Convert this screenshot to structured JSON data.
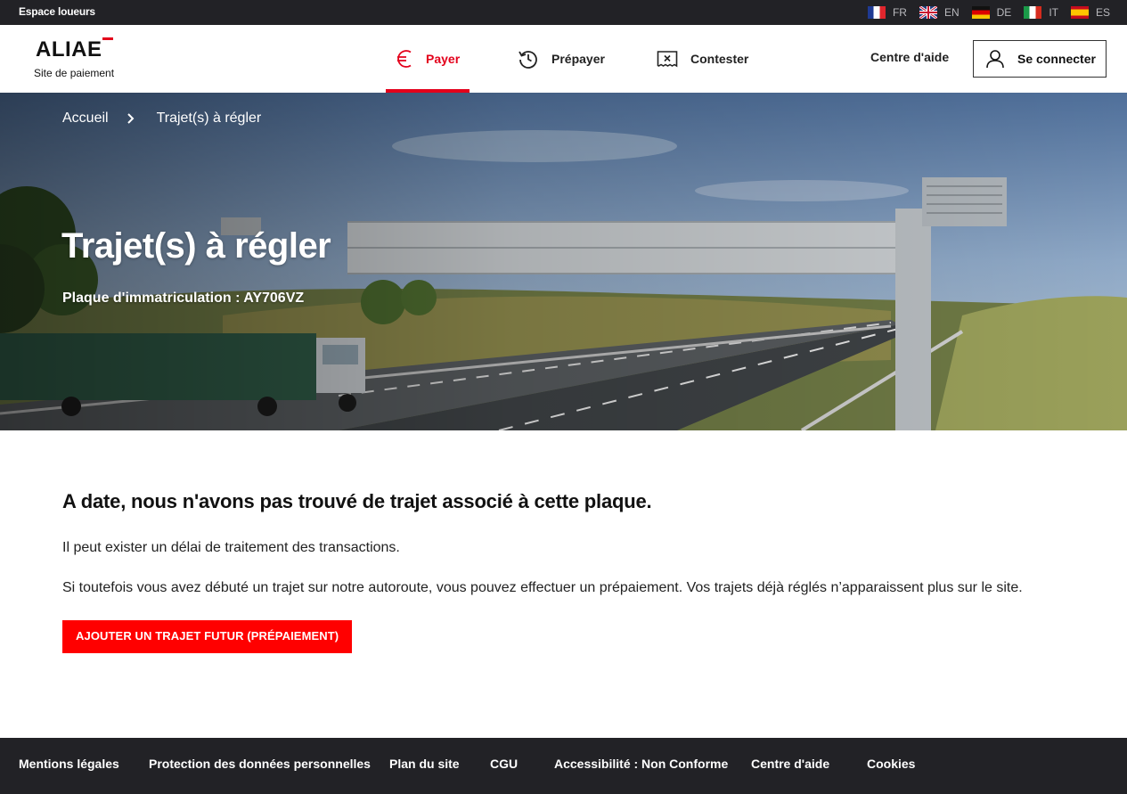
{
  "topbar": {
    "space_label": "Espace loueurs",
    "languages": [
      {
        "code": "FR",
        "flag": "france-flag-icon"
      },
      {
        "code": "EN",
        "flag": "uk-flag-icon"
      },
      {
        "code": "DE",
        "flag": "germany-flag-icon"
      },
      {
        "code": "IT",
        "flag": "italy-flag-icon"
      },
      {
        "code": "ES",
        "flag": "spain-flag-icon"
      }
    ]
  },
  "header": {
    "logo_text": "ALIAE",
    "logo_subtitle": "Site de paiement",
    "nav": [
      {
        "label": "Payer",
        "icon": "euro-icon",
        "active": true
      },
      {
        "label": "Prépayer",
        "icon": "clock-refresh-icon",
        "active": false
      },
      {
        "label": "Contester",
        "icon": "ticket-cancel-icon",
        "active": false
      }
    ],
    "help_label": "Centre d'aide",
    "login_label": "Se connecter",
    "accent_color": "#e3001b"
  },
  "hero": {
    "breadcrumb": [
      "Accueil",
      "Trajet(s) à régler"
    ],
    "title": "Trajet(s) à régler",
    "plate_label": "Plaque d'immatriculation :",
    "plate_value": "AY706VZ"
  },
  "main": {
    "heading": "A date, nous n'avons pas trouvé de trajet associé à cette plaque.",
    "paragraph_1": "Il peut exister un délai de traitement des transactions.",
    "paragraph_2": "Si toutefois vous avez débuté un trajet sur notre autoroute, vous pouvez effectuer un prépaiement. Vos trajets déjà réglés n’apparaissent plus sur le site.",
    "cta_label": "AJOUTER UN TRAJET FUTUR (PRÉPAIEMENT)",
    "cta_color": "#ff0000"
  },
  "footer": {
    "links": [
      "Mentions légales",
      "Protection des données personnelles",
      "Plan du site",
      "CGU",
      "Accessibilité : Non Conforme",
      "Centre d'aide",
      "Cookies"
    ]
  }
}
